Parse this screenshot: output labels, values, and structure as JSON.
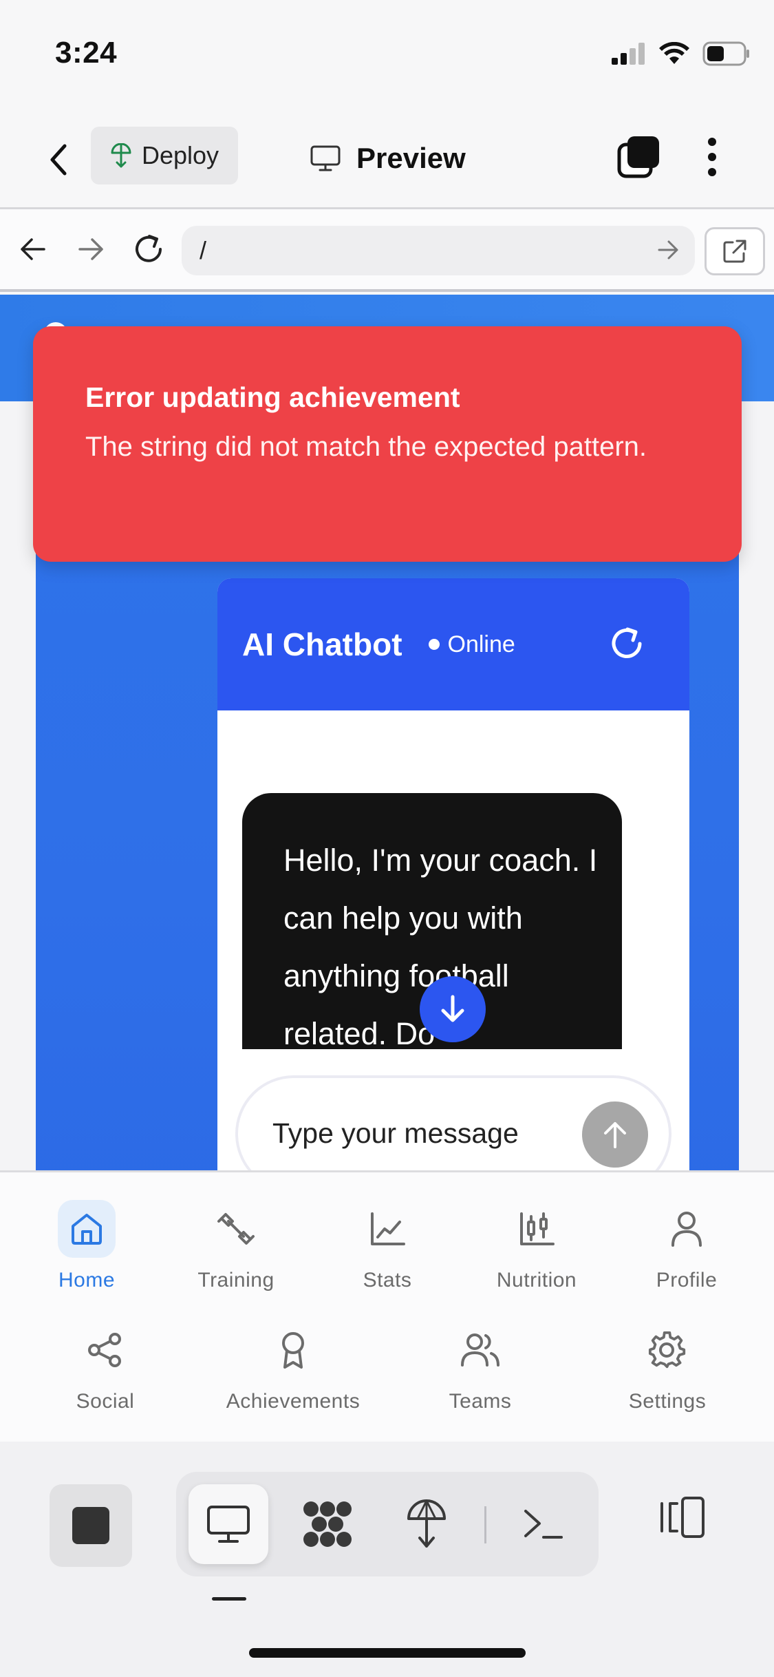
{
  "status_bar": {
    "time": "3:24"
  },
  "app_bar": {
    "deploy_label": "Deploy",
    "preview_label": "Preview"
  },
  "browser": {
    "url_value": "/"
  },
  "toast": {
    "title": "Error updating achievement",
    "message": "The string did not match the expected pattern."
  },
  "chatbot": {
    "title": "AI Chatbot",
    "status": "Online",
    "message": "Hello, I'm your coach. I can help you with anything football related. Do",
    "input_placeholder": "Type your message"
  },
  "bottom_nav": {
    "row1": [
      {
        "label": "Home",
        "icon": "home-icon",
        "active": true
      },
      {
        "label": "Training",
        "icon": "dumbbell-icon",
        "active": false
      },
      {
        "label": "Stats",
        "icon": "line-chart-icon",
        "active": false
      },
      {
        "label": "Nutrition",
        "icon": "candlestick-icon",
        "active": false
      },
      {
        "label": "Profile",
        "icon": "user-icon",
        "active": false
      }
    ],
    "row2": [
      {
        "label": "Social",
        "icon": "share-icon"
      },
      {
        "label": "Achievements",
        "icon": "award-icon"
      },
      {
        "label": "Teams",
        "icon": "users-icon"
      },
      {
        "label": "Settings",
        "icon": "gear-icon"
      }
    ]
  },
  "colors": {
    "toast_bg": "#ee4247",
    "chat_header": "#2c56f0",
    "hero_blue": "#2f7be8",
    "active_nav": "#2b79e3"
  }
}
